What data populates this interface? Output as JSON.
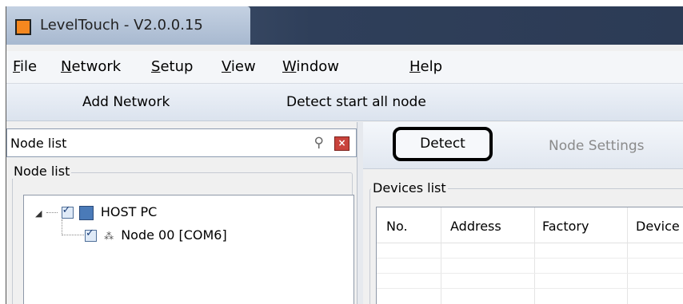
{
  "window": {
    "title": "LevelTouch - V2.0.0.15",
    "icon": "app-logo-icon"
  },
  "menu": {
    "items": [
      {
        "label": "File",
        "underline": "F",
        "rest": "ile"
      },
      {
        "label": "Network",
        "underline": "N",
        "rest": "etwork"
      },
      {
        "label": "Setup",
        "underline": "S",
        "rest": "etup"
      },
      {
        "label": "View",
        "underline": "V",
        "rest": "iew"
      },
      {
        "label": "Window",
        "underline": "W",
        "rest": "indow"
      },
      {
        "label": "Help",
        "underline": "H",
        "rest": "elp"
      }
    ]
  },
  "toolbar": {
    "add_network": "Add Network",
    "detect_all": "Detect start all node"
  },
  "node_panel": {
    "title": "Node list",
    "group_label": "Node list",
    "tree": {
      "root": "HOST PC",
      "child": "Node 00 [COM6]"
    }
  },
  "device_panel": {
    "detect_label": "Detect",
    "node_settings_label": "Node Settings",
    "group_label": "Devices list",
    "columns": [
      "No.",
      "Address",
      "Factory",
      "Device"
    ]
  },
  "colors": {
    "accent_icon": "#f5871f",
    "close_red": "#c9433c"
  }
}
